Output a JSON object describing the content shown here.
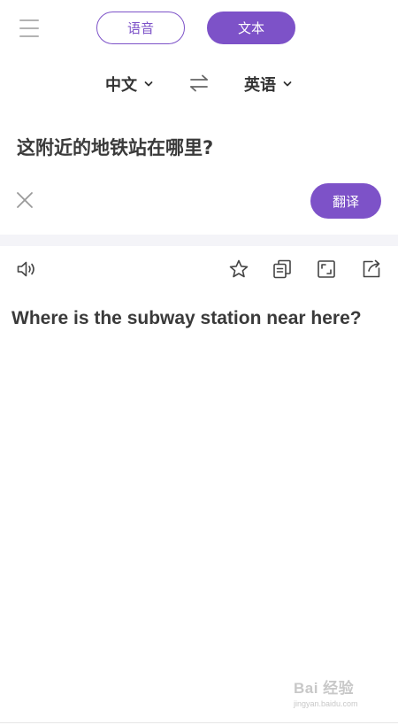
{
  "header": {
    "menu_icon": "menu-icon",
    "tabs": [
      {
        "label": "语音",
        "active": false
      },
      {
        "label": "文本",
        "active": true
      }
    ]
  },
  "languages": {
    "source": "中文",
    "target": "英语",
    "swap_icon": "swap-arrows-icon"
  },
  "input": {
    "text": "这附近的地铁站在哪里?",
    "clear_icon": "close-icon",
    "translate_label": "翻译"
  },
  "result": {
    "text": "Where is the subway station near here?",
    "toolbar_icons": [
      "speaker-icon",
      "star-icon",
      "copy-icon",
      "fullscreen-icon",
      "share-icon"
    ]
  },
  "watermark": {
    "brand": "Bai 经验",
    "site": "jingyan.baidu.com"
  },
  "colors": {
    "accent": "#7d52c8",
    "text": "#3a3a3a",
    "muted": "#b3b3b3",
    "band": "#f4f4f8"
  }
}
